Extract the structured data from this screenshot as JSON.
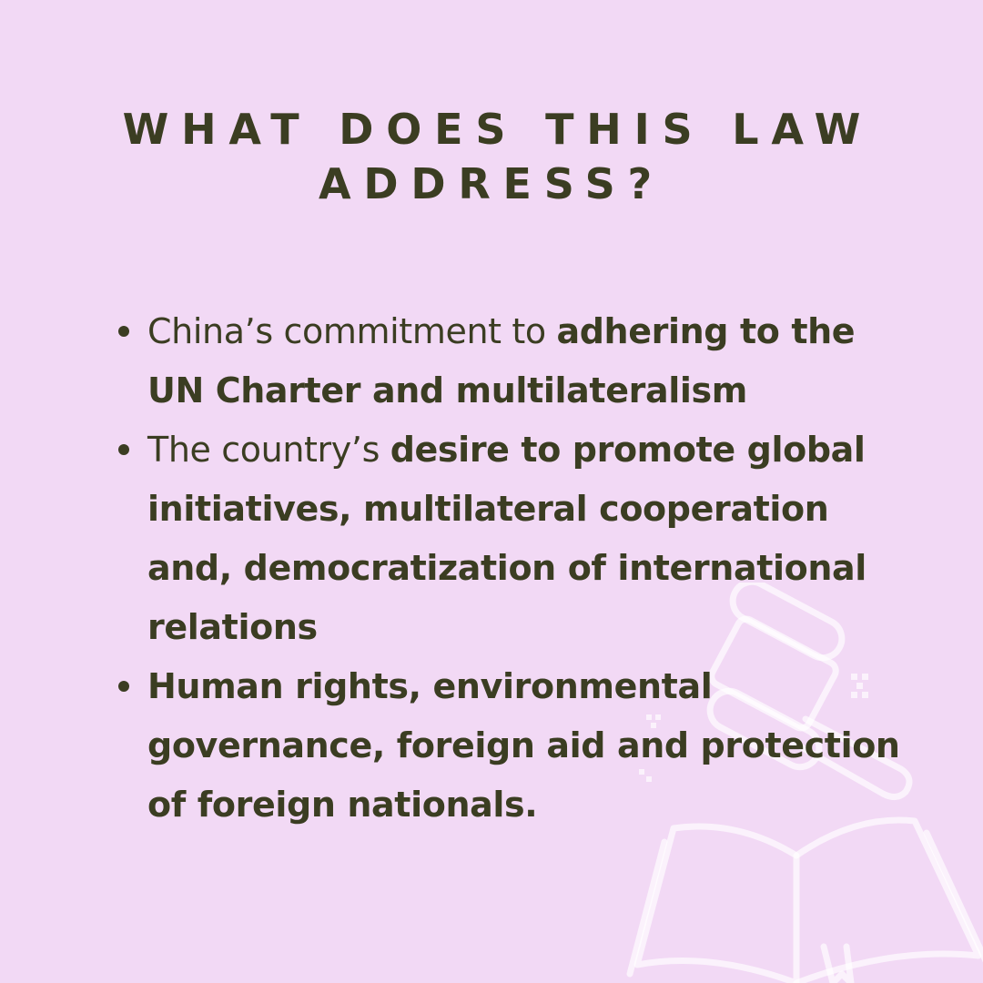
{
  "page": {
    "background": "#f2d9f5",
    "text_color": "#3b3d22",
    "accent_outline": "#ffffff"
  },
  "title": {
    "line1": "WHAT DOES THIS LAW",
    "line2": "ADDRESS?"
  },
  "bullets": [
    {
      "plain": "China’s commitment to ",
      "bold": "adhering to the UN Charter and multilateralism"
    },
    {
      "plain": "The country’s ",
      "bold": "desire to promote global initiatives, multilateral cooperation and, democratization of international relations"
    },
    {
      "plain": "",
      "bold": "Human rights, environmental governance, foreign aid and protection of foreign nationals."
    }
  ],
  "decoration": {
    "icons": [
      "gavel-icon",
      "open-book-icon"
    ]
  }
}
